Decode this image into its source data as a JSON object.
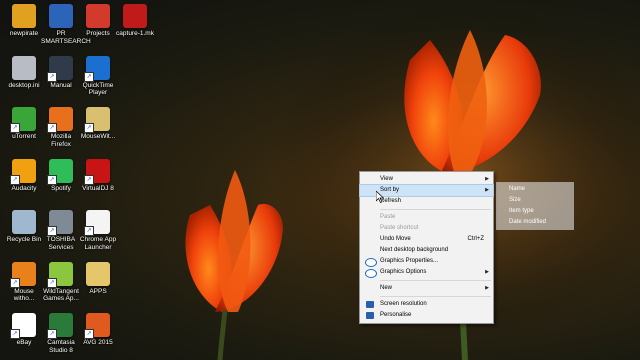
{
  "desktop": {
    "icons": [
      {
        "label": "newpirate",
        "color": "#e0a020",
        "col": 0,
        "row": 0,
        "shortcut": false
      },
      {
        "label": "PR SMARTSEARCH",
        "color": "#2b64b8",
        "col": 1,
        "row": 0,
        "shortcut": false
      },
      {
        "label": "Projects",
        "color": "#d23b2b",
        "col": 2,
        "row": 0,
        "shortcut": false
      },
      {
        "label": "capture-1.mk",
        "color": "#c01a1a",
        "col": 3,
        "row": 0,
        "shortcut": false
      },
      {
        "label": "desktop.ini",
        "color": "#b8bcc4",
        "col": 0,
        "row": 1,
        "shortcut": false
      },
      {
        "label": "Manual",
        "color": "#2f3a4a",
        "col": 1,
        "row": 1,
        "shortcut": true
      },
      {
        "label": "QuickTime Player",
        "color": "#1b6fd0",
        "col": 2,
        "row": 1,
        "shortcut": true
      },
      {
        "label": "uTorrent",
        "color": "#3aa63a",
        "col": 0,
        "row": 2,
        "shortcut": true
      },
      {
        "label": "Mozilla Firefox",
        "color": "#e8701c",
        "col": 1,
        "row": 2,
        "shortcut": true
      },
      {
        "label": "MouseWit...",
        "color": "#d8c070",
        "col": 2,
        "row": 2,
        "shortcut": true
      },
      {
        "label": "Audacity",
        "color": "#f0a010",
        "col": 0,
        "row": 3,
        "shortcut": true
      },
      {
        "label": "Spotify",
        "color": "#2ebd59",
        "col": 1,
        "row": 3,
        "shortcut": true
      },
      {
        "label": "VirtualDJ 8",
        "color": "#c81414",
        "col": 2,
        "row": 3,
        "shortcut": true
      },
      {
        "label": "Recycle Bin",
        "color": "#9fb7cf",
        "col": 0,
        "row": 4,
        "shortcut": false
      },
      {
        "label": "TOSHIBA Services",
        "color": "#7e8a96",
        "col": 1,
        "row": 4,
        "shortcut": true
      },
      {
        "label": "Chrome App Launcher",
        "color": "#f4f4f4",
        "col": 2,
        "row": 4,
        "shortcut": true
      },
      {
        "label": "Mouse witho...",
        "color": "#e8801c",
        "col": 0,
        "row": 5,
        "shortcut": true
      },
      {
        "label": "WildTangent Games Ap...",
        "color": "#8cc63f",
        "col": 1,
        "row": 5,
        "shortcut": true
      },
      {
        "label": "APPS",
        "color": "#e6c66a",
        "col": 2,
        "row": 5,
        "shortcut": false
      },
      {
        "label": "eBay",
        "color": "#ffffff",
        "col": 0,
        "row": 6,
        "shortcut": true
      },
      {
        "label": "Camtasia Studio 8",
        "color": "#2a7a3a",
        "col": 1,
        "row": 6,
        "shortcut": true
      },
      {
        "label": "AVG 2015",
        "color": "#e05a20",
        "col": 2,
        "row": 6,
        "shortcut": true
      }
    ]
  },
  "context_menu": {
    "items": [
      {
        "label": "View",
        "type": "item",
        "submenu": true,
        "shortcut": "",
        "disabled": false,
        "highlight": false,
        "icon": ""
      },
      {
        "label": "Sort by",
        "type": "item",
        "submenu": true,
        "shortcut": "",
        "disabled": false,
        "highlight": true,
        "icon": ""
      },
      {
        "label": "Refresh",
        "type": "item",
        "submenu": false,
        "shortcut": "",
        "disabled": false,
        "highlight": false,
        "icon": ""
      },
      {
        "type": "separator"
      },
      {
        "label": "Paste",
        "type": "item",
        "submenu": false,
        "shortcut": "",
        "disabled": true,
        "highlight": false,
        "icon": ""
      },
      {
        "label": "Paste shortcut",
        "type": "item",
        "submenu": false,
        "shortcut": "",
        "disabled": true,
        "highlight": false,
        "icon": ""
      },
      {
        "label": "Undo Move",
        "type": "item",
        "submenu": false,
        "shortcut": "Ctrl+Z",
        "disabled": false,
        "highlight": false,
        "icon": ""
      },
      {
        "label": "Next desktop background",
        "type": "item",
        "submenu": false,
        "shortcut": "",
        "disabled": false,
        "highlight": false,
        "icon": ""
      },
      {
        "label": "Graphics Properties...",
        "type": "item",
        "submenu": false,
        "shortcut": "",
        "disabled": false,
        "highlight": false,
        "icon": "intel-graphics-icon"
      },
      {
        "label": "Graphics Options",
        "type": "item",
        "submenu": true,
        "shortcut": "",
        "disabled": false,
        "highlight": false,
        "icon": "intel-graphics-icon"
      },
      {
        "type": "separator"
      },
      {
        "label": "New",
        "type": "item",
        "submenu": true,
        "shortcut": "",
        "disabled": false,
        "highlight": false,
        "icon": ""
      },
      {
        "type": "separator"
      },
      {
        "label": "Screen resolution",
        "type": "item",
        "submenu": false,
        "shortcut": "",
        "disabled": false,
        "highlight": false,
        "icon": "screen-resolution-icon"
      },
      {
        "label": "Personalise",
        "type": "item",
        "submenu": false,
        "shortcut": "",
        "disabled": false,
        "highlight": false,
        "icon": "personalise-icon"
      }
    ]
  },
  "sort_submenu": {
    "items": [
      "Name",
      "Size",
      "Item type",
      "Date modified"
    ]
  },
  "colors": {
    "highlight": "#cfe3f7",
    "intel": "#1a6bc0"
  }
}
